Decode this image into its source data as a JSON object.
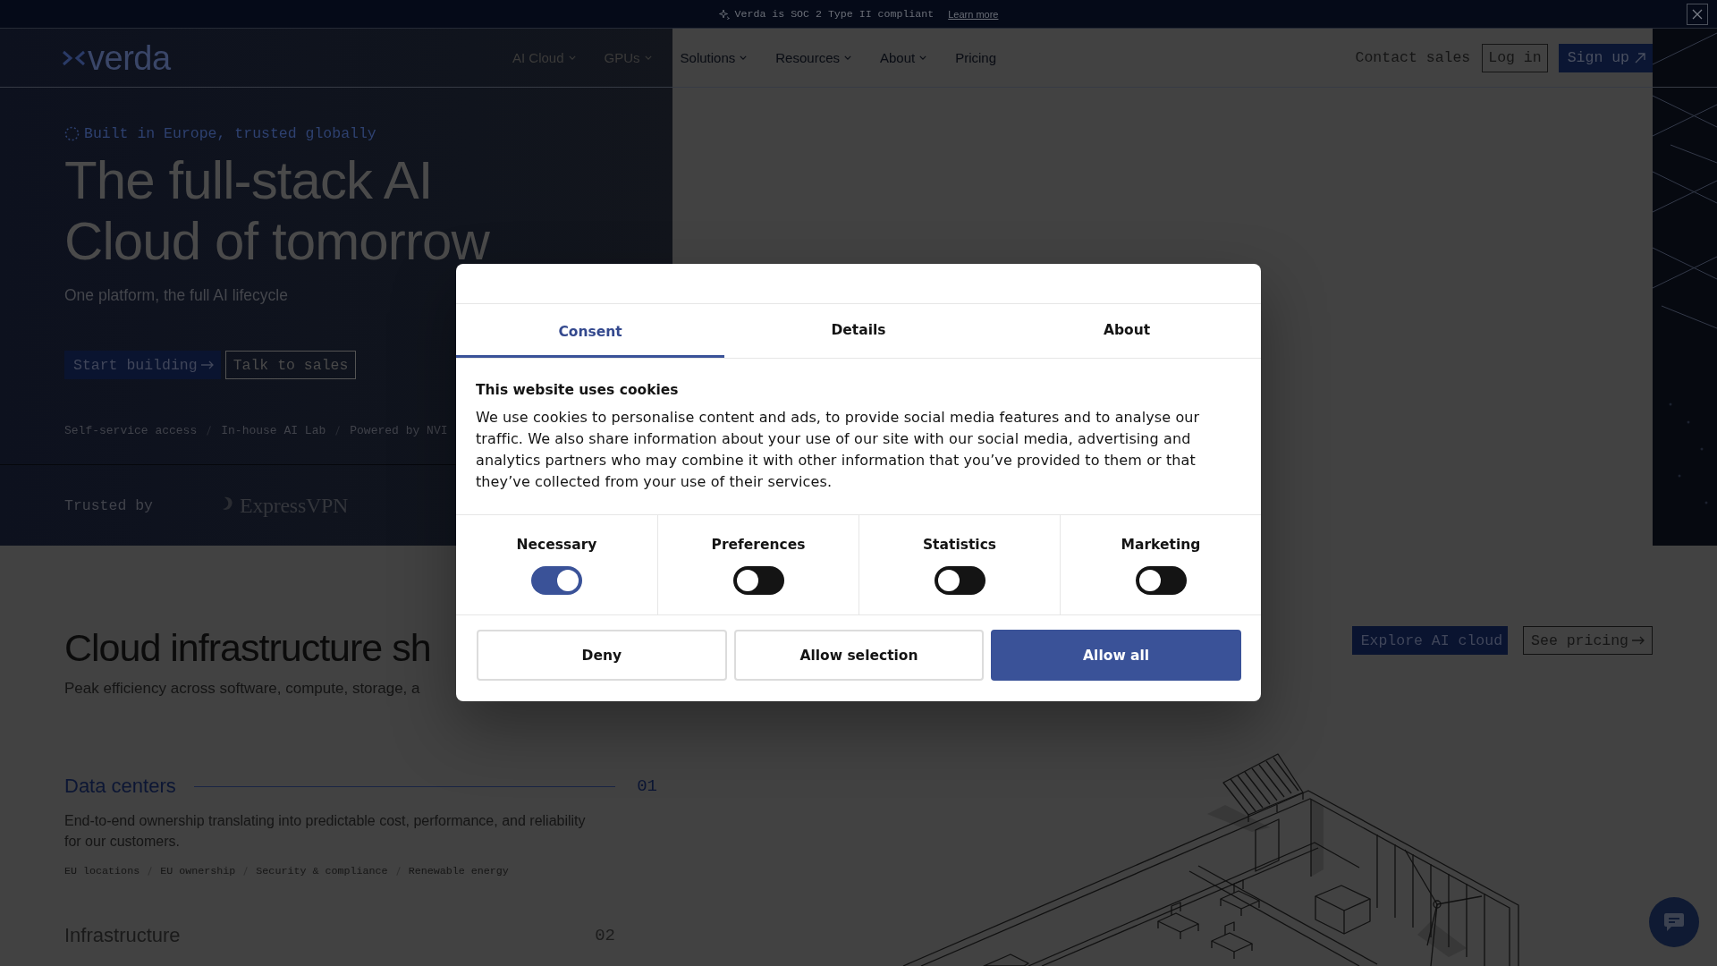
{
  "announcement": {
    "text": "Verda is SOC 2 Type II compliant",
    "link": "Learn more"
  },
  "nav": {
    "logo": "verda",
    "links": [
      {
        "label": "AI Cloud",
        "dropdown": true
      },
      {
        "label": "GPUs",
        "dropdown": true
      },
      {
        "label": "Solutions",
        "dropdown": true
      },
      {
        "label": "Resources",
        "dropdown": true
      },
      {
        "label": "About",
        "dropdown": true
      },
      {
        "label": "Pricing",
        "dropdown": false
      }
    ],
    "contact": "Contact sales",
    "login": "Log in",
    "signup": "Sign up"
  },
  "hero": {
    "eyebrow": "Built in Europe, trusted globally",
    "title_lines": [
      "The full-stack AI",
      "Cloud of tomorrow"
    ],
    "subtitle": "One platform, the full AI lifecycle",
    "buttons": [
      {
        "label": "Start building",
        "kind": "primary",
        "arrow": true
      },
      {
        "label": "Talk to sales",
        "kind": "outline",
        "arrow": false
      }
    ],
    "proof_points": [
      "Self-service access",
      "In-house AI Lab",
      "Powered by NVI"
    ],
    "trusted_label": "Trusted by",
    "logos": [
      "ExpressVPN"
    ]
  },
  "infrastructure": {
    "title": "Cloud infrastructure sh",
    "subtitle": "Peak efficiency across software, compute, storage, a",
    "buttons": [
      {
        "label": "Explore AI cloud",
        "kind": "primary",
        "arrow": false
      },
      {
        "label": "See pricing",
        "kind": "outline",
        "arrow": true
      }
    ],
    "items": [
      {
        "title": "Data centers",
        "number": "01",
        "expanded": true,
        "description": "End-to-end ownership translating into predictable cost, performance, and reliability for our customers.",
        "tags": [
          "EU locations",
          "EU ownership",
          "Security & compliance",
          "Renewable energy"
        ]
      },
      {
        "title": "Infrastructure",
        "number": "02",
        "expanded": false
      }
    ]
  },
  "cookie_dialog": {
    "tabs": [
      {
        "label": "Consent",
        "selected": true
      },
      {
        "label": "Details",
        "selected": false
      },
      {
        "label": "About",
        "selected": false
      }
    ],
    "heading": "This website uses cookies",
    "body": "We use cookies to personalise content and ads, to provide social media features and to analyse our traffic. We also share information about your use of our site with our social media, advertising and analytics partners who may combine it with other information that you’ve provided to them or that they’ve collected from your use of their services.",
    "toggles": [
      {
        "label": "Necessary",
        "on": true
      },
      {
        "label": "Preferences",
        "on": false
      },
      {
        "label": "Statistics",
        "on": false
      },
      {
        "label": "Marketing",
        "on": false
      }
    ],
    "buttons": [
      {
        "label": "Deny",
        "kind": "secondary"
      },
      {
        "label": "Allow selection",
        "kind": "secondary"
      },
      {
        "label": "Allow all",
        "kind": "primary"
      }
    ]
  }
}
